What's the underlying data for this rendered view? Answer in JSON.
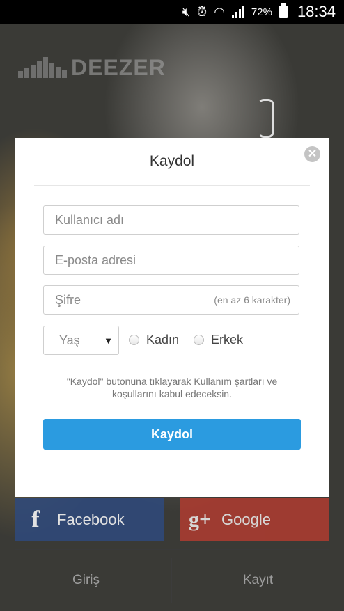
{
  "status_bar": {
    "battery_percent": "72%",
    "time": "18:34",
    "icons": [
      "mute-icon",
      "alarm-icon",
      "wifi-icon",
      "signal-icon",
      "battery-icon"
    ]
  },
  "brand": {
    "logo_text": "DEEZER"
  },
  "modal": {
    "title": "Kaydol",
    "close_icon": "close-icon",
    "username_placeholder": "Kullanıcı adı",
    "email_placeholder": "E-posta adresi",
    "password_placeholder": "Şifre",
    "password_hint": "(en az 6 karakter)",
    "age_label": "Yaş",
    "gender_female": "Kadın",
    "gender_male": "Erkek",
    "terms_text": "\"Kaydol\" butonuna tıklayarak Kullanım şartları ve koşullarını kabul edeceksin.",
    "submit_label": "Kaydol"
  },
  "social": {
    "facebook_icon_text": "f",
    "facebook_label": "Facebook",
    "google_icon_text": "g+",
    "google_label": "Google"
  },
  "bottom_nav": {
    "login": "Giriş",
    "register": "Kayıt"
  },
  "colors": {
    "primary_button": "#2b9be0",
    "facebook": "#2f4a7d",
    "google": "#b83c30"
  }
}
